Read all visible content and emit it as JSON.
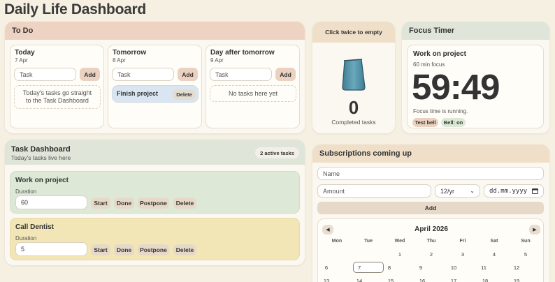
{
  "page": {
    "title": "Daily Life Dashboard"
  },
  "todo": {
    "header": "To Do",
    "columns": [
      {
        "title": "Today",
        "date": "7 Apr",
        "placeholder": "Task",
        "add_label": "Add",
        "hint": "Today's tasks go straight to the Task Dashboard"
      },
      {
        "title": "Tomorrow",
        "date": "8 Apr",
        "placeholder": "Task",
        "add_label": "Add",
        "task": "Finish project",
        "delete_label": "Delete"
      },
      {
        "title": "Day after tomorrow",
        "date": "9 Apr",
        "placeholder": "Task",
        "add_label": "Add",
        "hint": "No tasks here yet"
      }
    ]
  },
  "jar": {
    "hint": "Click twice to empty",
    "count": "0",
    "label": "Completed tasks",
    "accent": "#4f8ea3"
  },
  "focus": {
    "header": "Focus Timer",
    "task": "Work on project",
    "subtitle": "60 min focus",
    "time": "59:49",
    "status": "Focus time is running.",
    "test_bell": "Test bell",
    "bell": "Bell: on"
  },
  "dashboard": {
    "header": "Task Dashboard",
    "subheader": "Today's tasks live here",
    "badge": "2 active tasks",
    "tasks": [
      {
        "title": "Work on project",
        "duration_label": "Duration",
        "duration": "60",
        "start": "Start",
        "done": "Done",
        "postpone": "Postpone",
        "delete": "Delete",
        "color": "#dde9d6"
      },
      {
        "title": "Call Dentist",
        "duration_label": "Duration",
        "duration": "5",
        "start": "Start",
        "done": "Done",
        "postpone": "Postpone",
        "delete": "Delete",
        "color": "#f2e6b6"
      }
    ]
  },
  "subs": {
    "header": "Subscriptions coming up",
    "name_placeholder": "Name",
    "amount_placeholder": "Amount",
    "period": "12/yr",
    "date_placeholder": "dd.mm.yyyy",
    "add_label": "Add",
    "calendar": {
      "month": "April 2026",
      "prev": "◀",
      "next": "▶",
      "weekdays": [
        "Mon",
        "Tue",
        "Wed",
        "Thu",
        "Fri",
        "Sat",
        "Sun"
      ],
      "rows": [
        [
          "",
          "",
          "1",
          "2",
          "3",
          "4",
          "5"
        ],
        [
          "6",
          "7",
          "8",
          "9",
          "10",
          "11",
          "12"
        ],
        [
          "13",
          "14",
          "15",
          "16",
          "17",
          "18",
          "19"
        ]
      ],
      "selected": "7"
    }
  }
}
